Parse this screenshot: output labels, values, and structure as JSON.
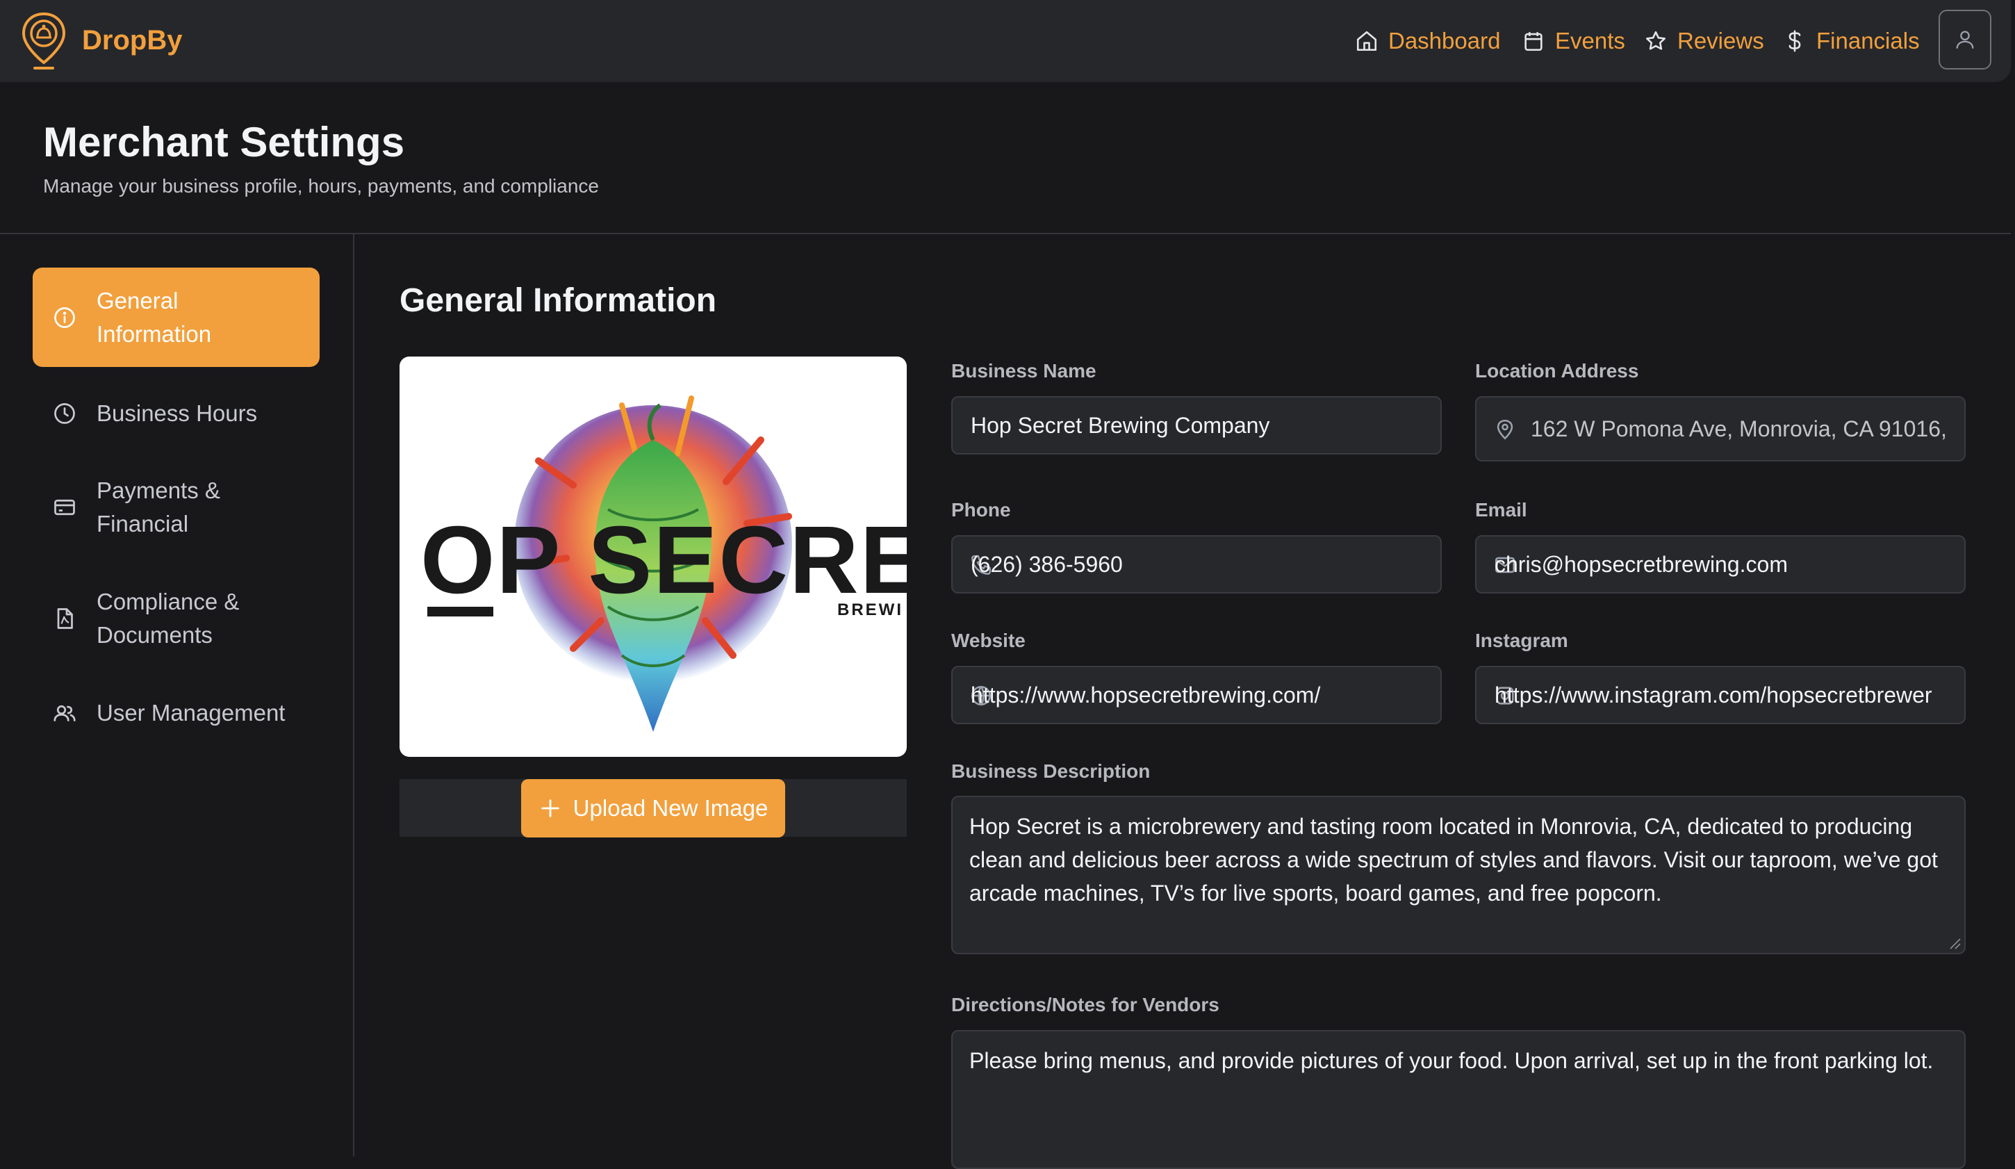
{
  "app": {
    "brand": "DropBy"
  },
  "nav": {
    "dashboard": "Dashboard",
    "events": "Events",
    "reviews": "Reviews",
    "financials": "Financials"
  },
  "page": {
    "title": "Merchant Settings",
    "subtitle": "Manage your business profile, hours, payments, and compliance"
  },
  "sidebar": {
    "items": [
      {
        "label": "General\nInformation",
        "icon": "info-icon",
        "active": true
      },
      {
        "label": "Business Hours",
        "icon": "clock-icon",
        "active": false
      },
      {
        "label": "Payments &\nFinancial",
        "icon": "credit-card-icon",
        "active": false
      },
      {
        "label": "Compliance &\nDocuments",
        "icon": "document-icon",
        "active": false
      },
      {
        "label": "User Management",
        "icon": "users-icon",
        "active": false
      }
    ]
  },
  "section": {
    "title": "General Information"
  },
  "logo_image": {
    "main_text": "OP SECRE",
    "sub_text": "BREWI"
  },
  "upload": {
    "label": "Upload New Image"
  },
  "form": {
    "business_name": {
      "label": "Business Name",
      "value": "Hop Secret Brewing Company"
    },
    "location": {
      "label": "Location Address",
      "value": "162 W Pomona Ave, Monrovia, CA 91016,"
    },
    "phone": {
      "label": "Phone",
      "value": "(626) 386-5960"
    },
    "email": {
      "label": "Email",
      "value": "chris@hopsecretbrewing.com"
    },
    "website": {
      "label": "Website",
      "value": "https://www.hopsecretbrewing.com/"
    },
    "instagram": {
      "label": "Instagram",
      "value": "https://www.instagram.com/hopsecretbrewer"
    },
    "description": {
      "label": "Business Description",
      "value": "Hop Secret is a microbrewery and tasting room located in Monrovia, CA, dedicated to producing clean and delicious beer across a wide spectrum of styles and flavors. Visit our taproom, we’ve got arcade machines, TV’s for live sports, board games, and free popcorn."
    },
    "directions": {
      "label": "Directions/Notes for Vendors",
      "value": "Please bring menus, and provide pictures of your food. Upon arrival, set up in the front parking lot."
    }
  },
  "colors": {
    "accent": "#f2a03d",
    "background": "#18181b",
    "surface": "#27282c"
  }
}
